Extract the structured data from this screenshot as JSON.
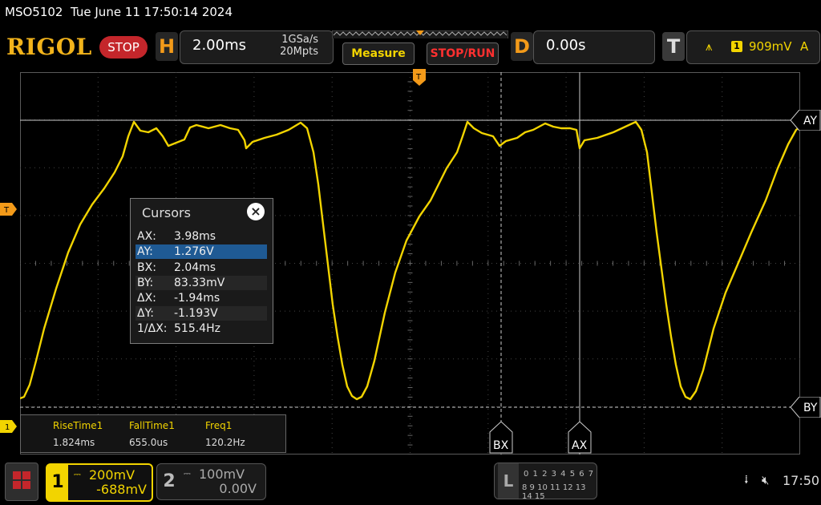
{
  "status": {
    "model": "MSO5102",
    "datetime": "Tue June 11 17:50:14 2024"
  },
  "header": {
    "logo": "RIGOL",
    "run_state": "STOP",
    "horizontal": {
      "letter": "H",
      "timebase": "2.00ms",
      "sample_rate": "1GSa/s",
      "memory_depth": "20Mpts"
    },
    "measure_label": "Measure",
    "stoprun_label": "STOP/RUN",
    "delay": {
      "letter": "D",
      "value": "0.00s"
    },
    "trigger": {
      "letter": "T",
      "channel": "1",
      "level": "909mV",
      "mode": "A"
    }
  },
  "markers": {
    "trigger_left": "T",
    "ch1_ground": "1",
    "cursor_ay": "AY",
    "cursor_by": "BY",
    "cursor_bx": "BX",
    "cursor_ax": "AX"
  },
  "cursors": {
    "title": "Cursors",
    "close_glyph": "×",
    "rows": [
      {
        "key": "AX:",
        "value": "3.98ms"
      },
      {
        "key": "AY:",
        "value": "1.276V"
      },
      {
        "key": "BX:",
        "value": "2.04ms"
      },
      {
        "key": "BY:",
        "value": "83.33mV"
      },
      {
        "key": "ΔX:",
        "value": "-1.94ms"
      },
      {
        "key": "ΔY:",
        "value": "-1.193V"
      },
      {
        "key": "1/ΔX:",
        "value": "515.4Hz"
      }
    ]
  },
  "measurements": [
    {
      "label": "RiseTime1",
      "value": "1.824ms"
    },
    {
      "label": "FallTime1",
      "value": "655.0us"
    },
    {
      "label": "Freq1",
      "value": "120.2Hz"
    }
  ],
  "channels": {
    "ch1": {
      "number": "1",
      "scale": "200mV",
      "offset": "-688mV"
    },
    "ch2": {
      "number": "2",
      "scale": "100mV",
      "offset": "0.00V"
    }
  },
  "logic": {
    "letter": "L",
    "row1": "0 1 2 3  4 5 6 7",
    "row2": "8 9 10 11 12 13 14 15"
  },
  "system": {
    "time": "17:50",
    "usb_icon": "usb-icon",
    "speaker_icon": "speaker-muted-icon"
  },
  "colors": {
    "ch1": "#f2d400",
    "accent_orange": "#f39a19",
    "stop_red": "#c4262b",
    "grid": "#5a5a5a",
    "background": "#000000"
  }
}
